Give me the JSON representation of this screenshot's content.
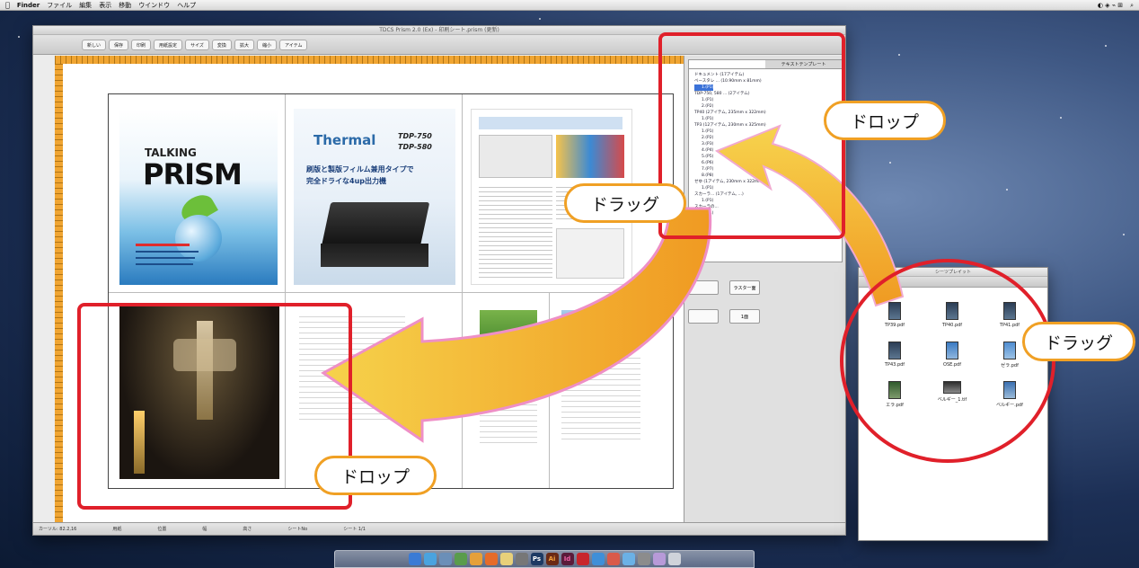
{
  "menubar": {
    "apple": "",
    "app_name": "Finder",
    "menus": [
      "ファイル",
      "編集",
      "表示",
      "移動",
      "ウインドウ",
      "ヘルプ"
    ]
  },
  "main_window": {
    "title": "TDCS Prism 2.0 (Ex) - 印刷シート.prism (更新)",
    "toolbar_buttons": [
      "新しい",
      "保存",
      "印刷",
      "用紙設定",
      "サイズ",
      "変換",
      "拡大",
      "縮小",
      "アイテム"
    ],
    "status_items": [
      "カーソル: 82.2,16",
      "用紙",
      "位置",
      "幅",
      "高さ",
      "シートNo",
      "シート 1/1"
    ],
    "panel_tabs": [
      "",
      "テキストテンプレート"
    ],
    "tree_items": [
      "ドキュメント (17アイテム)",
      "ベースタレ ... (10.90mm x 81mm)",
      "1.(P1)",
      "TDP-750, 580 ... (2アイテム)",
      "1.(P1)",
      "2.(P2)",
      "TP40 (2アイテム, 235mm x 322mm)",
      "1.(P1)",
      "TP3 (12アイテム, 230mm x 325mm)",
      "1.(P1)",
      "2.(P2)",
      "3.(P3)",
      "4.(P4)",
      "5.(P5)",
      "6.(P6)",
      "7.(P7)",
      "8.(P8)",
      "せゆ (1アイテム, 230mm x 322mm)",
      "1.(P1)",
      "スカーラ... (1アイテム, ...)",
      "1.(P1)",
      "スカーラの...",
      "1.(P1)"
    ],
    "panel_buttons": [
      "",
      "ラスター面",
      "",
      "1面"
    ]
  },
  "document": {
    "page1": {
      "line1": "TALKING",
      "line2": "PRISM"
    },
    "page2": {
      "heading": "Thermal",
      "model1": "TDP-750",
      "model2": "TDP-580",
      "tagline1": "刷版と製版フィルム兼用タイプで",
      "tagline2": "完全ドライな4up出力機"
    }
  },
  "file_window": {
    "title": "シーツプレイット",
    "files": [
      "TP39.pdf",
      "TP40.pdf",
      "TP41.pdf",
      "TP43.pdf",
      "OSE.pdf",
      "ゼラ.pdf",
      "エラ.pdf",
      "ベルギー_1.tif",
      "ベルギー.pdf"
    ]
  },
  "dock_icons": [
    "finder",
    "safari",
    "mail",
    "photos",
    "chrome",
    "firefox",
    "notes",
    "calendar",
    "photoshop",
    "illustrator",
    "indesign",
    "acrobat",
    "preview",
    "ical",
    "itunes",
    "settings",
    "messages",
    "trash"
  ],
  "annotations": {
    "drop_top": "ドロップ",
    "drag_middle": "ドラッグ",
    "drag_right": "ドラッグ",
    "drop_bottom": "ドロップ"
  },
  "colors": {
    "highlight_red": "#e0202a",
    "arrow_orange": "#f0a024",
    "label_border": "#f0a024"
  }
}
